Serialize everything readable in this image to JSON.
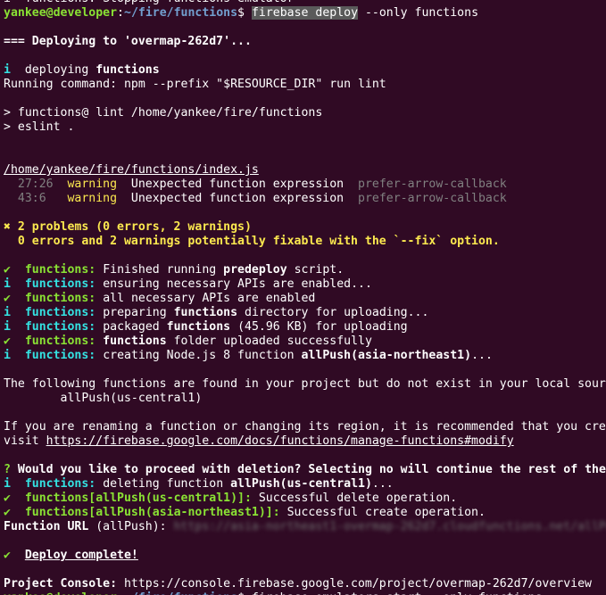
{
  "window": {
    "background": "#300a24",
    "palette": {
      "default": "#ffffff",
      "green": "#8ae234",
      "blue": "#729fcf",
      "cyan": "#34e2e2",
      "yellow": "#fce94f",
      "gray": "#808080",
      "selection": "#5a5a5a",
      "blurred": "#6e6e6e"
    }
  },
  "lines": [
    [
      {
        "t": "i  functions: Stopping functions emulator"
      }
    ],
    [
      {
        "t": "yankee@developer",
        "c": "green",
        "b": true
      },
      {
        "t": ":"
      },
      {
        "t": "~/fire/functions",
        "c": "blue",
        "b": true
      },
      {
        "t": "$ "
      },
      {
        "t": "firebase deploy",
        "hl": true,
        "role": "command"
      },
      {
        "t": " --only functions"
      }
    ],
    [],
    [
      {
        "t": "=== Deploying to 'overmap-262d7'...",
        "b": true
      }
    ],
    [],
    [
      {
        "t": "i",
        "c": "cyan",
        "b": true
      },
      {
        "t": "  deploying "
      },
      {
        "t": "functions",
        "b": true
      }
    ],
    [
      {
        "t": "Running command: npm --prefix \"$RESOURCE_DIR\" run lint"
      }
    ],
    [],
    [
      {
        "t": "> functions@ lint /home/yankee/fire/functions"
      }
    ],
    [
      {
        "t": "> eslint ."
      }
    ],
    [],
    [],
    [
      {
        "t": "/home/yankee/fire/functions/index.js",
        "u": true,
        "role": "link"
      }
    ],
    [
      {
        "t": "  27:26",
        "c": "gray"
      },
      {
        "t": "  "
      },
      {
        "t": "warning",
        "c": "yellow"
      },
      {
        "t": "  Unexpected function expression  "
      },
      {
        "t": "prefer-arrow-callback",
        "c": "gray"
      }
    ],
    [
      {
        "t": "  43:6 ",
        "c": "gray"
      },
      {
        "t": "  "
      },
      {
        "t": "warning",
        "c": "yellow"
      },
      {
        "t": "  Unexpected function expression  "
      },
      {
        "t": "prefer-arrow-callback",
        "c": "gray"
      }
    ],
    [],
    [
      {
        "t": "✖ 2 problems (0 errors, 2 warnings)",
        "c": "yellow",
        "b": true
      }
    ],
    [
      {
        "t": "  0 errors and 2 warnings potentially fixable with the `--fix` option.",
        "c": "yellow",
        "b": true
      }
    ],
    [],
    [
      {
        "t": "✔",
        "c": "green",
        "b": true
      },
      {
        "t": "  "
      },
      {
        "t": "functions:",
        "c": "green",
        "b": true
      },
      {
        "t": " Finished running "
      },
      {
        "t": "predeploy",
        "b": true
      },
      {
        "t": " script."
      }
    ],
    [
      {
        "t": "i",
        "c": "cyan",
        "b": true
      },
      {
        "t": "  "
      },
      {
        "t": "functions:",
        "c": "cyan",
        "b": true
      },
      {
        "t": " ensuring necessary APIs are enabled..."
      }
    ],
    [
      {
        "t": "✔",
        "c": "green",
        "b": true
      },
      {
        "t": "  "
      },
      {
        "t": "functions:",
        "c": "green",
        "b": true
      },
      {
        "t": " all necessary APIs are enabled"
      }
    ],
    [
      {
        "t": "i",
        "c": "cyan",
        "b": true
      },
      {
        "t": "  "
      },
      {
        "t": "functions:",
        "c": "cyan",
        "b": true
      },
      {
        "t": " preparing "
      },
      {
        "t": "functions",
        "b": true
      },
      {
        "t": " directory for uploading..."
      }
    ],
    [
      {
        "t": "i",
        "c": "cyan",
        "b": true
      },
      {
        "t": "  "
      },
      {
        "t": "functions:",
        "c": "cyan",
        "b": true
      },
      {
        "t": " packaged "
      },
      {
        "t": "functions",
        "b": true
      },
      {
        "t": " (45.96 KB) for uploading"
      }
    ],
    [
      {
        "t": "✔",
        "c": "green",
        "b": true
      },
      {
        "t": "  "
      },
      {
        "t": "functions:",
        "c": "green",
        "b": true
      },
      {
        "t": " "
      },
      {
        "t": "functions",
        "b": true
      },
      {
        "t": " folder uploaded successfully"
      }
    ],
    [
      {
        "t": "i",
        "c": "cyan",
        "b": true
      },
      {
        "t": "  "
      },
      {
        "t": "functions:",
        "c": "cyan",
        "b": true
      },
      {
        "t": " creating Node.js 8 function "
      },
      {
        "t": "allPush(asia-northeast1)",
        "b": true
      },
      {
        "t": "..."
      }
    ],
    [],
    [
      {
        "t": "The following functions are found in your project but do not exist in your local source code:"
      }
    ],
    [
      {
        "t": "        allPush(us-central1)"
      }
    ],
    [],
    [
      {
        "t": "If you are renaming a function or changing its region, it is recommended that you create the new function first before deleting the old one to prevent event loss. For more info,"
      }
    ],
    [
      {
        "t": "visit "
      },
      {
        "t": "https://firebase.google.com/docs/functions/manage-functions#modify",
        "u": true,
        "role": "link"
      }
    ],
    [],
    [
      {
        "t": "?",
        "c": "green",
        "b": true
      },
      {
        "t": " "
      },
      {
        "t": "Would you like to proceed with deletion? Selecting no will continue the rest of the deployments.",
        "b": true
      }
    ],
    [
      {
        "t": "i",
        "c": "cyan",
        "b": true
      },
      {
        "t": "  "
      },
      {
        "t": "functions:",
        "c": "cyan",
        "b": true
      },
      {
        "t": " deleting function "
      },
      {
        "t": "allPush(us-central1)",
        "b": true
      },
      {
        "t": "..."
      }
    ],
    [
      {
        "t": "✔",
        "c": "green",
        "b": true
      },
      {
        "t": "  "
      },
      {
        "t": "functions[allPush(us-central1)]:",
        "c": "green",
        "b": true
      },
      {
        "t": " Successful delete operation."
      }
    ],
    [
      {
        "t": "✔",
        "c": "green",
        "b": true
      },
      {
        "t": "  "
      },
      {
        "t": "functions[allPush(asia-northeast1)]:",
        "c": "green",
        "b": true
      },
      {
        "t": " Successful create operation."
      }
    ],
    [
      {
        "t": "Function URL",
        "b": true
      },
      {
        "t": " (allPush): "
      },
      {
        "t": "https://asia-northeast1-overmap-262d7.cloudfunctions.net/allPush",
        "c": "blurred",
        "blur": true
      }
    ],
    [],
    [
      {
        "t": "✔",
        "c": "green",
        "b": true
      },
      {
        "t": "  "
      },
      {
        "t": "Deploy complete!",
        "b": true,
        "u": true
      }
    ],
    [],
    [
      {
        "t": "Project Console:",
        "b": true
      },
      {
        "t": " https://console.firebase.google.com/project/overmap-262d7/overview"
      }
    ],
    [
      {
        "t": "yankee@developer",
        "c": "green",
        "b": true
      },
      {
        "t": ":"
      },
      {
        "t": "~/fire/functions",
        "c": "blue",
        "b": true
      },
      {
        "t": "$ firebase emulators:start --only functions"
      }
    ]
  ]
}
